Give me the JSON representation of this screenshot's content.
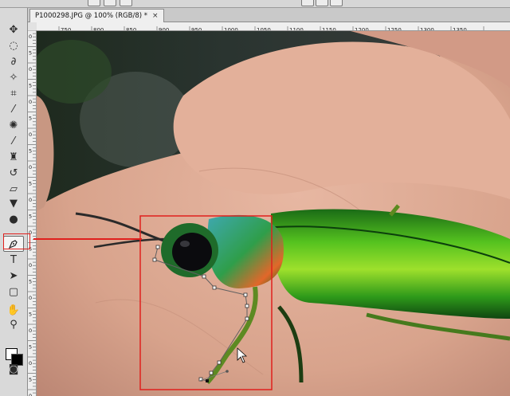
{
  "document_tab": {
    "title": "P1000298.JPG @ 100% (RGB/8) *",
    "close_glyph": "×"
  },
  "ruler": {
    "horizontal_labels": [
      "750",
      "800",
      "850",
      "900",
      "950",
      "1000",
      "1050",
      "1100",
      "1150",
      "1200",
      "1250",
      "1300",
      "1350"
    ],
    "vertical_labels": [
      "0",
      "5",
      "0",
      "5",
      "0",
      "5",
      "0",
      "5",
      "0",
      "5",
      "0",
      "5",
      "0",
      "5",
      "0",
      "5",
      "0",
      "5",
      "0",
      "5",
      "0",
      "5",
      "0"
    ]
  },
  "toolbox": {
    "tools": [
      {
        "name": "move-tool",
        "glyph": "▸✥"
      },
      {
        "name": "marquee-tool",
        "glyph": "◌"
      },
      {
        "name": "lasso-tool",
        "glyph": "ᘓ"
      },
      {
        "name": "magic-wand-tool",
        "glyph": "✧"
      },
      {
        "name": "crop-tool",
        "glyph": "⌗"
      },
      {
        "name": "eyedropper-tool",
        "glyph": "⚲"
      },
      {
        "name": "healing-brush-tool",
        "glyph": "✺"
      },
      {
        "name": "brush-tool",
        "glyph": "🖌"
      },
      {
        "name": "clone-stamp-tool",
        "glyph": "▲"
      },
      {
        "name": "history-brush-tool",
        "glyph": "↺"
      },
      {
        "name": "eraser-tool",
        "glyph": "▱"
      },
      {
        "name": "paint-bucket-tool",
        "glyph": "▼"
      },
      {
        "name": "blur-tool",
        "glyph": "●"
      },
      {
        "name": "dodge-tool",
        "glyph": "●"
      },
      {
        "name": "pen-tool",
        "glyph": "✒"
      },
      {
        "name": "type-tool",
        "glyph": "T"
      },
      {
        "name": "path-selection-tool",
        "glyph": "➤"
      },
      {
        "name": "shape-tool",
        "glyph": "▢"
      },
      {
        "name": "hand-tool",
        "glyph": "✋"
      },
      {
        "name": "zoom-tool",
        "glyph": "🔍"
      }
    ],
    "active_tool": "pen-tool",
    "foreground_color": "#ffffff",
    "background_color": "#000000"
  },
  "colors": {
    "annotation": "#e0201d",
    "beetle_green": "#2fa31d",
    "skin": "#d7a28b"
  },
  "path_anchor_points": 11
}
